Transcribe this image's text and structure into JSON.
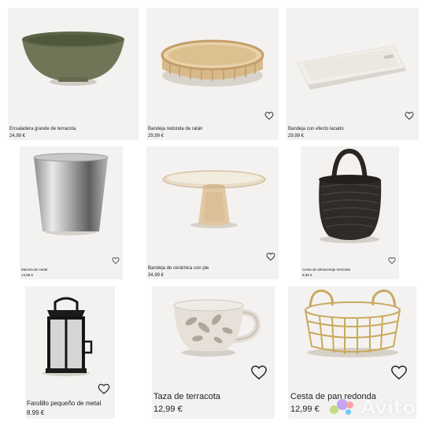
{
  "products": [
    {
      "name": "Ensaladera grande de terracota",
      "price": "24,99 €"
    },
    {
      "name": "Bandeja redonda de ratán",
      "price": "29,99 €"
    },
    {
      "name": "Bandeja con efecto lacado",
      "price": "29,99 €"
    },
    {
      "name": "Maceta de metal",
      "price": "14,99 €"
    },
    {
      "name": "Bandeja de cerámica con pie",
      "price": "34,99 €"
    },
    {
      "name": "Cesta de almacenaje trenzada",
      "price": "8,99 €"
    },
    {
      "name": "Farolillo pequeño de metal",
      "price": "8.99 €"
    },
    {
      "name": "Taza de terracota",
      "price": "12,99 €"
    },
    {
      "name": "Cesta de pan redonda",
      "price": "12,99 €"
    }
  ],
  "icons": {
    "favorite": "heart-outline-icon"
  },
  "watermark": {
    "text": "Avito",
    "dot_colors": [
      "#97cf26",
      "#a169f7",
      "#ff6163",
      "#0af"
    ]
  },
  "colors": {
    "card_bg": "#f3f2f0",
    "text": "#222222"
  }
}
